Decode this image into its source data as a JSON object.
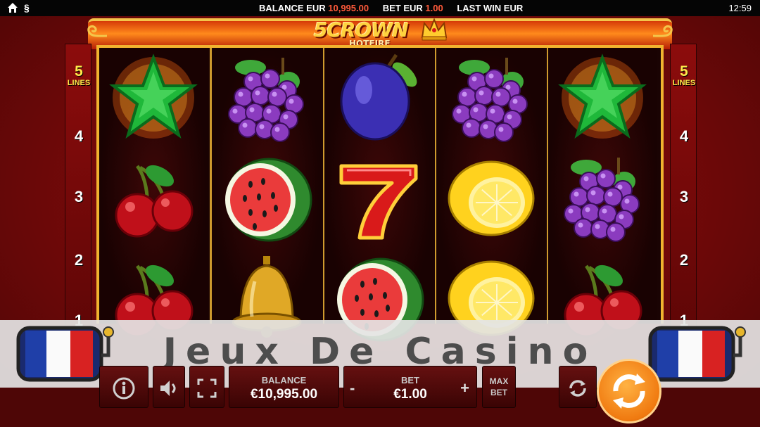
{
  "topbar": {
    "icons": [
      "home-icon",
      "paragraph-icon"
    ],
    "section_symbol": "§",
    "balance_label": "BALANCE EUR",
    "balance_value": "10,995.00",
    "bet_label": "BET EUR",
    "bet_value": "1.00",
    "last_win_label": "LAST WIN EUR",
    "clock": "12:59"
  },
  "logo": {
    "title": "5CROWN",
    "subtitle": "HOTFIRE",
    "icon": "crown-icon"
  },
  "lines": {
    "top_number": "5",
    "top_label": "LINES",
    "numbers": [
      "4",
      "3",
      "2",
      "1"
    ]
  },
  "reels": [
    [
      "star-symbol",
      "cherry-symbol",
      "cherry-symbol"
    ],
    [
      "grapes-symbol",
      "watermelon-symbol",
      "bell-symbol"
    ],
    [
      "plum-symbol",
      "seven-symbol",
      "watermelon-symbol"
    ],
    [
      "grapes-symbol",
      "lemon-symbol",
      "lemon-symbol"
    ],
    [
      "star-symbol",
      "grapes-symbol",
      "cherry-symbol"
    ]
  ],
  "banner": {
    "text": "Jeux De Casino",
    "icon": "slot-reel-flag-icon"
  },
  "controls": {
    "info_icon": "info-icon",
    "sound_icon": "sound-icon",
    "fullscreen_icon": "fullscreen-icon",
    "balance_label": "BALANCE",
    "balance_value": "€10,995.00",
    "bet_label": "BET",
    "bet_value": "€1.00",
    "minus": "-",
    "plus": "+",
    "maxbet_line1": "MAX",
    "maxbet_line2": "BET",
    "autoplay_icon": "autoplay-icon",
    "spin_icon": "spin-icon"
  },
  "colors": {
    "accent_gold": "#f1b32f",
    "background_red": "#7c0a0a",
    "spin_orange": "#f07a10"
  }
}
